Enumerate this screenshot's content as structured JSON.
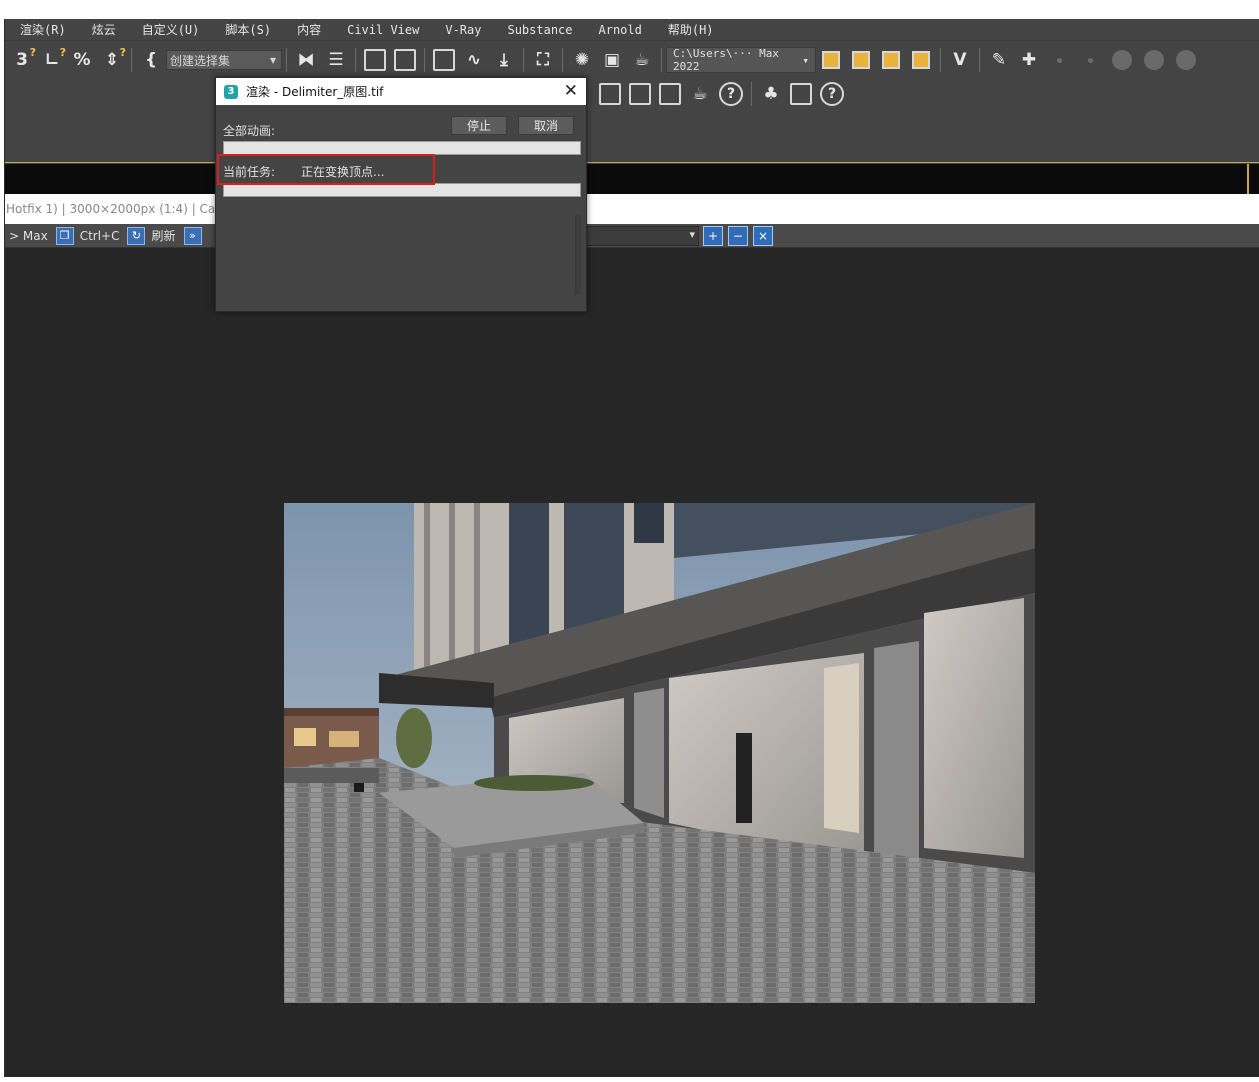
{
  "menu": [
    "渲染(R)",
    "炫云",
    "自定义(U)",
    "脚本(S)",
    "内容",
    "Civil View",
    "V-Ray",
    "Substance",
    "Arnold",
    "帮助(H)"
  ],
  "toolbar": {
    "selection_set_placeholder": "创建选择集",
    "project_path": "C:\\Users\\··· Max 2022"
  },
  "status_strip": {
    "text": "Hotfix 1) | 3000×2000px (1:4) | Came"
  },
  "vfb": {
    "max_label": "> Max",
    "copy_label": "Ctrl+C",
    "refresh_label": "刷新"
  },
  "dialog": {
    "title": "渲染 - Delimiter_原图.tif",
    "app_badge": "3",
    "close_glyph": "✕",
    "total_label": "全部动画:",
    "stop_label": "停止",
    "cancel_label": "取消",
    "task_label": "当前任务:",
    "task_value": "正在变换顶点...",
    "total_progress": 0,
    "task_progress": 0
  },
  "colors": {
    "accent_yellow": "#c8a83c",
    "highlight_red": "#d81e1e",
    "icon_blue": "#2f6db8"
  }
}
